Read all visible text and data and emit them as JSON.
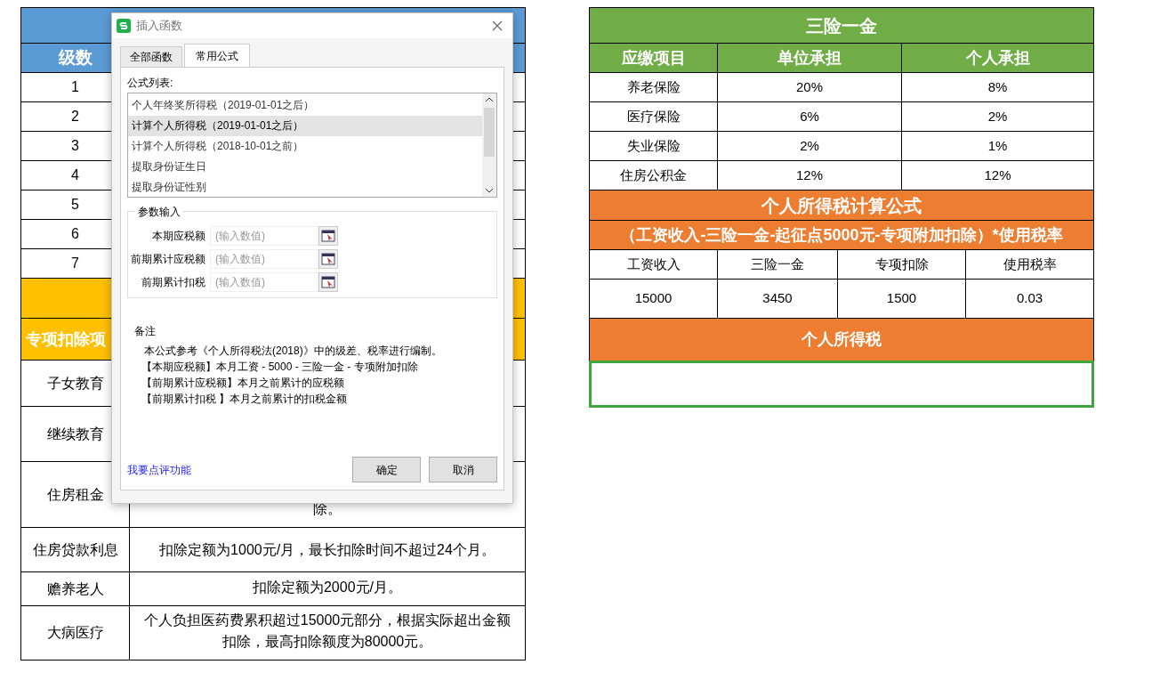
{
  "left_table": {
    "level_header": "级数",
    "levels": [
      "1",
      "2",
      "3",
      "4",
      "5",
      "6",
      "7"
    ],
    "deduction_header": "专项扣除项",
    "deductions": [
      {
        "item": "子女教育"
      },
      {
        "item": "继续教育"
      },
      {
        "item": "住房租金",
        "description": "除。"
      },
      {
        "item": "住房贷款利息",
        "description": "扣除定额为1000元/月，最长扣除时间不超过24个月。"
      },
      {
        "item": "赡养老人",
        "description": "扣除定额为2000元/月。"
      },
      {
        "item": "大病医疗",
        "description": "个人负担医药费累积超过15000元部分，根据实际超出金额扣除，最高扣除额度为80000元。"
      }
    ]
  },
  "dialog": {
    "title": "插入函数",
    "tabs": [
      {
        "label": "全部函数",
        "selected": false
      },
      {
        "label": "常用公式",
        "selected": true
      }
    ],
    "list_label": "公式列表:",
    "formulas": [
      {
        "label": "个人年终奖所得税（2019-01-01之后）",
        "selected": false
      },
      {
        "label": "计算个人所得税（2019-01-01之后）",
        "selected": true
      },
      {
        "label": "计算个人所得税（2018-10-01之前）",
        "selected": false
      },
      {
        "label": "提取身份证生日",
        "selected": false
      },
      {
        "label": "提取身份证性别",
        "selected": false
      }
    ],
    "params_label": "参数输入",
    "params": [
      {
        "label": "本期应税额",
        "placeholder": "(输入数值)"
      },
      {
        "label": "前期累计应税额",
        "placeholder": "(输入数值)"
      },
      {
        "label": "前期累计扣税",
        "placeholder": "(输入数值)"
      }
    ],
    "remarks_label": "备注",
    "remarks": [
      "本公式参考《个人所得税法(2018)》中的级差、税率进行编制。",
      "【本期应税额】本月工资 - 5000 - 三险一金 - 专项附加扣除",
      "【前期累计应税额】本月之前累计的应税额",
      "【前期累计扣税 】本月之前累计的扣税金额"
    ],
    "feedback_link": "我要点评功能",
    "buttons": [
      "确定",
      "取消"
    ]
  },
  "insurance": {
    "title": "三险一金",
    "columns": [
      "应缴项目",
      "单位承担",
      "个人承担"
    ],
    "rows": [
      [
        "养老保险",
        "20%",
        "8%"
      ],
      [
        "医疗保险",
        "6%",
        "2%"
      ],
      [
        "失业保险",
        "2%",
        "1%"
      ],
      [
        "住房公积金",
        "12%",
        "12%"
      ]
    ]
  },
  "tax_formula": {
    "title": "个人所得税计算公式",
    "formula": "（工资收入-三险一金-起征点5000元-专项附加扣除）*使用税率",
    "columns": [
      "工资收入",
      "三险一金",
      "专项扣除",
      "使用税率"
    ],
    "values": [
      "15000",
      "3450",
      "1500",
      "0.03"
    ],
    "result_title": "个人所得税",
    "result_cell": {
      "selected": true
    }
  }
}
